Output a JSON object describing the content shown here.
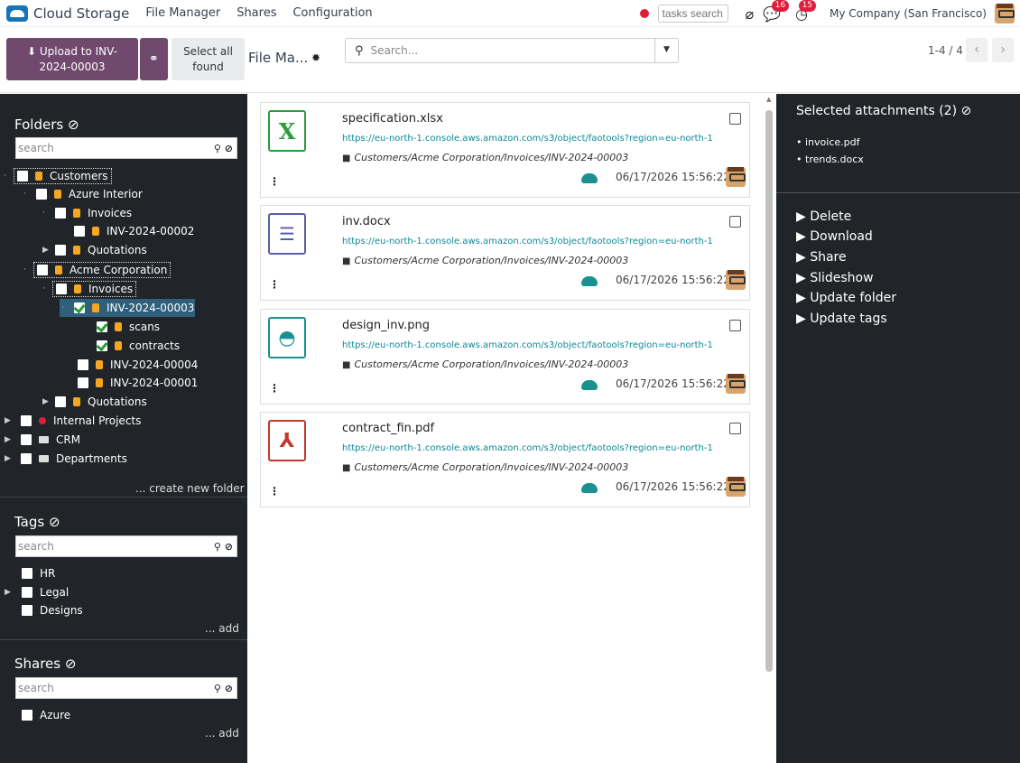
{
  "navbar": {
    "app_name": "Cloud Storage",
    "menus": [
      "File Manager",
      "Shares",
      "Configuration"
    ],
    "tasks_search_placeholder": "tasks search",
    "chat_badge": "16",
    "activity_badge": "15",
    "company": "My Company (San Francisco)"
  },
  "control_panel": {
    "upload_label_line1": "⬇ Upload to INV-",
    "upload_label_line2": "2024-00003",
    "select_all_line1": "Select all",
    "select_all_line2": "found",
    "breadcrumb": "File Ma...",
    "search_placeholder": "Search...",
    "pager": "1-4 / 4"
  },
  "folders": {
    "title": "Folders",
    "search_placeholder": "search",
    "items": [
      {
        "label": "Customers"
      },
      {
        "label": "Azure Interior"
      },
      {
        "label": "Invoices"
      },
      {
        "label": "INV-2024-00002"
      },
      {
        "label": "Quotations"
      },
      {
        "label": "Acme Corporation"
      },
      {
        "label": "Invoices"
      },
      {
        "label": "INV-2024-00003"
      },
      {
        "label": "scans"
      },
      {
        "label": "contracts"
      },
      {
        "label": "INV-2024-00004"
      },
      {
        "label": "INV-2024-00001"
      },
      {
        "label": "Quotations"
      },
      {
        "label": "Internal Projects"
      },
      {
        "label": "CRM"
      },
      {
        "label": "Departments"
      }
    ],
    "create_link": "... create new folder"
  },
  "tags": {
    "title": "Tags",
    "search_placeholder": "search",
    "items": [
      {
        "label": "HR"
      },
      {
        "label": "Legal"
      },
      {
        "label": "Designs"
      }
    ],
    "add_link": "... add"
  },
  "shares": {
    "title": "Shares",
    "search_placeholder": "search",
    "items": [
      {
        "label": "Azure"
      }
    ],
    "add_link": "... add"
  },
  "files": [
    {
      "name": "specification.xlsx",
      "url": "https://eu-north-1.console.aws.amazon.com/s3/object/faotools?region=eu-north-1",
      "path": "Customers/Acme Corporation/Invoices/INV-2024-00003",
      "date": "06/17/2026 15:56:22",
      "icon": "excel-icon"
    },
    {
      "name": "inv.docx",
      "url": "https://eu-north-1.console.aws.amazon.com/s3/object/faotools?region=eu-north-1",
      "path": "Customers/Acme Corporation/Invoices/INV-2024-00003",
      "date": "06/17/2026 15:56:22",
      "icon": "document-icon"
    },
    {
      "name": "design_inv.png",
      "url": "https://eu-north-1.console.aws.amazon.com/s3/object/faotools?region=eu-north-1",
      "path": "Customers/Acme Corporation/Invoices/INV-2024-00003",
      "date": "06/17/2026 15:56:22",
      "icon": "image-icon"
    },
    {
      "name": "contract_fin.pdf",
      "url": "https://eu-north-1.console.aws.amazon.com/s3/object/faotools?region=eu-north-1",
      "path": "Customers/Acme Corporation/Invoices/INV-2024-00003",
      "date": "06/17/2026 15:56:22",
      "icon": "pdf-icon"
    }
  ],
  "right_panel": {
    "title": "Selected attachments (2)",
    "selected": [
      "invoice.pdf",
      "trends.docx"
    ],
    "actions": [
      "Delete",
      "Download",
      "Share",
      "Slideshow",
      "Update folder",
      "Update tags"
    ]
  },
  "colors": {
    "primary": "#71486e",
    "sidebar_bg": "#212529",
    "link_teal": "#0a8a96",
    "badge_red": "#e01e3c"
  }
}
